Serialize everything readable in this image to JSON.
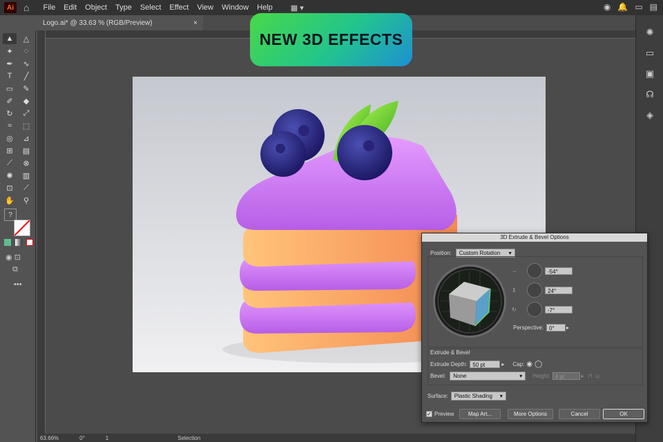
{
  "menubar": {
    "logo": "Ai",
    "items": [
      "File",
      "Edit",
      "Object",
      "Type",
      "Select",
      "Effect",
      "View",
      "Window",
      "Help"
    ]
  },
  "document": {
    "tab_title": "Logo.ai* @ 33.63 % (RGB/Preview)"
  },
  "banner": {
    "text": "NEW 3D EFFECTS"
  },
  "statusbar": {
    "zoom": "63.66%",
    "rotation": "0°",
    "artboard": "1",
    "tool": "Selection"
  },
  "dialog": {
    "title": "3D Extrude & Bevel Options",
    "position_label": "Position:",
    "position_value": "Custom Rotation",
    "x_rot": "-54°",
    "y_rot": "24°",
    "z_rot": "-7°",
    "perspective_label": "Perspective:",
    "perspective_value": "0°",
    "extrude_section": "Extrude & Bevel",
    "extrude_depth_label": "Extrude Depth:",
    "extrude_depth_value": "50 pt",
    "cap_label": "Cap:",
    "bevel_label": "Bevel:",
    "bevel_value": "None",
    "height_label": "Height:",
    "height_value": "4 pt",
    "surface_label": "Surface:",
    "surface_value": "Plastic Shading",
    "preview_label": "Preview",
    "map_art": "Map Art...",
    "more_options": "More Options",
    "cancel": "Cancel",
    "ok": "OK"
  },
  "colors": {
    "accent": "#ff6e2a",
    "banner_start": "#49d848",
    "banner_end": "#1e8fd3"
  }
}
